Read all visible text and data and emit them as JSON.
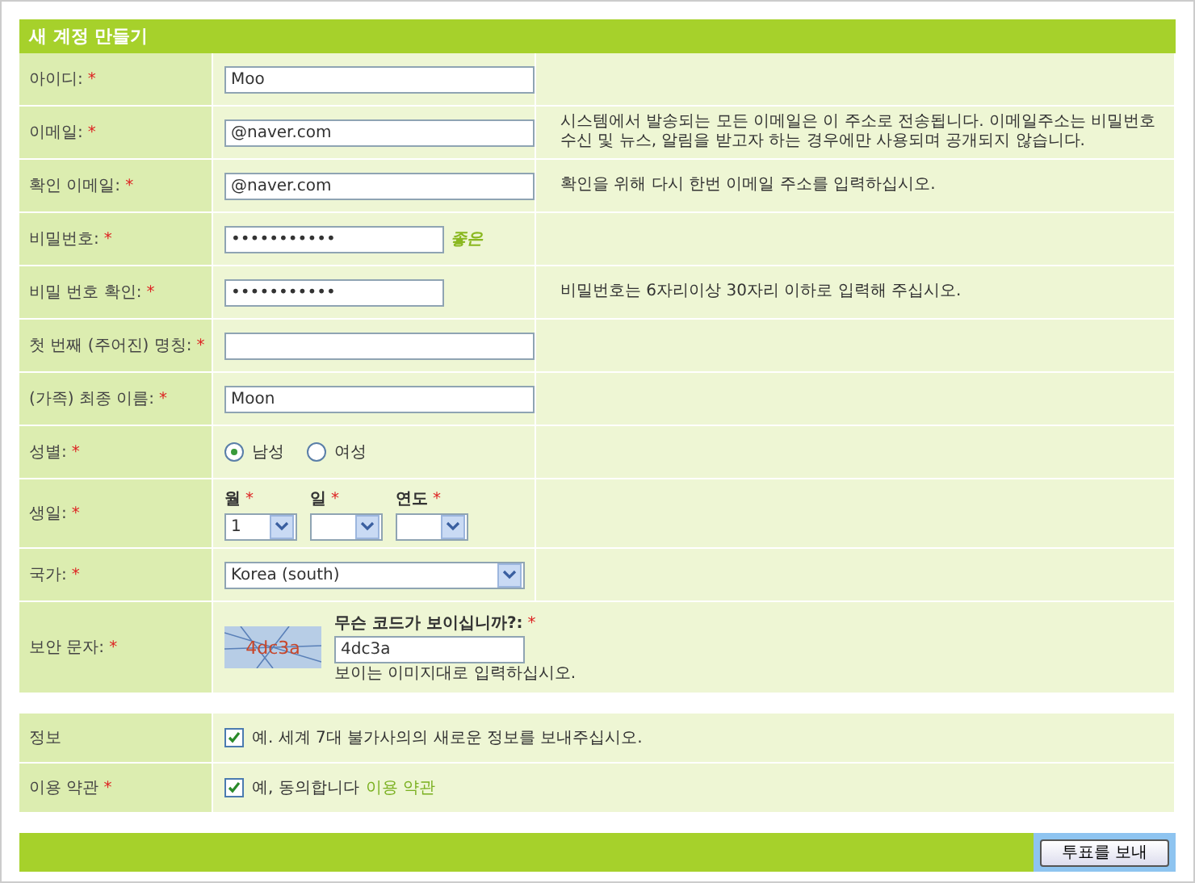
{
  "title": "새 계정 만들기",
  "fields": [
    {
      "kind": "text",
      "label": "아이디:",
      "mark": "*",
      "value": "Moo"
    },
    {
      "kind": "text",
      "label": "이메일:",
      "mark": "*",
      "value": "@naver.com",
      "hint": "시스템에서 발송되는 모든 이메일은 이 주소로 전송됩니다. 이메일주소는 비밀번호수신 및 뉴스, 알림을 받고자 하는 경우에만 사용되며 공개되지 않습니다."
    },
    {
      "kind": "text",
      "label": "확인 이메일:",
      "mark": "*",
      "value": "@naver.com",
      "hint": "확인을 위해 다시 한번 이메일 주소를 입력하십시오."
    },
    {
      "kind": "password",
      "label": "비밀번호:",
      "mark": "*",
      "value": "•••••••••••",
      "strength": "좋은"
    },
    {
      "kind": "password",
      "label": "비밀 번호 확인:",
      "mark": "*",
      "value": "•••••••••••",
      "hint": "비밀번호는 6자리이상 30자리 이하로 입력해 주십시오."
    },
    {
      "kind": "text",
      "label": "첫 번째 (주어진) 명칭:",
      "mark": "*"
    },
    {
      "kind": "text",
      "label": "(가족) 최종 이름:",
      "mark": "*",
      "value": "Moon"
    },
    {
      "kind": "radio",
      "label": "성별:",
      "mark": "*",
      "options": [
        {
          "label": "남성",
          "selected": true
        },
        {
          "label": "여성",
          "selected": false
        }
      ]
    },
    {
      "kind": "date",
      "label": "생일:",
      "mark": "*",
      "parts": [
        {
          "label": "월",
          "mark": "*",
          "value": "1"
        },
        {
          "label": "일",
          "mark": "*"
        },
        {
          "label": "연도",
          "mark": "*"
        }
      ]
    },
    {
      "kind": "select",
      "label": "국가:",
      "mark": "*",
      "value": "Korea (south)"
    },
    {
      "kind": "captcha",
      "label": "보안 문자:",
      "mark": "*",
      "captcha_text": "4dc3a",
      "question": "무슨 코드가 보이십니까?:",
      "question_mark": "*",
      "value": "4dc3a",
      "note": "보이는 이미지대로 입력하십시오."
    }
  ],
  "options": [
    {
      "label": "정보",
      "text": "예. 세계 7대 불가사의의 새로운 정보를 보내주십시오.",
      "checked": true
    },
    {
      "label": "이용 약관",
      "mark": "*",
      "text": "예, 동의합니다",
      "link": "이용 약관",
      "checked": true
    }
  ],
  "submit": "투표를 보내"
}
